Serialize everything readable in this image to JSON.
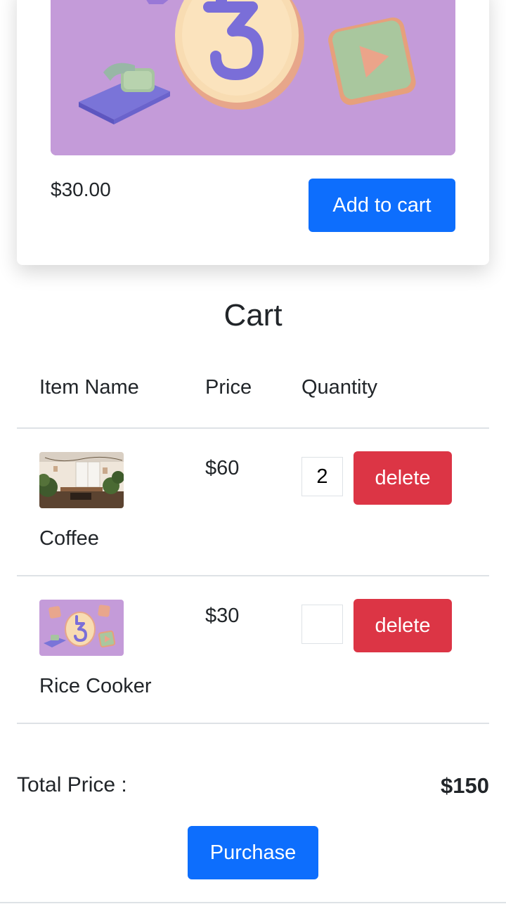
{
  "product": {
    "price": "$30.00",
    "add_to_cart_label": "Add to cart",
    "image_icon": "tezos-coin-illustration"
  },
  "cart": {
    "title": "Cart",
    "columns": [
      "Item Name",
      "Price",
      "Quantity"
    ],
    "items": [
      {
        "name": "Coffee",
        "price": "$60",
        "quantity": "2",
        "delete_label": "delete",
        "image_icon": "cafe-room-photo"
      },
      {
        "name": "Rice Cooker",
        "price": "$30",
        "quantity": "",
        "delete_label": "delete",
        "image_icon": "tezos-coin-illustration"
      }
    ],
    "total_label": "Total Price :",
    "total_value": "$150",
    "purchase_label": "Purchase"
  },
  "colors": {
    "primary": "#0d6efd",
    "danger": "#dc3545",
    "illustration_bg": "#c49bd9"
  }
}
